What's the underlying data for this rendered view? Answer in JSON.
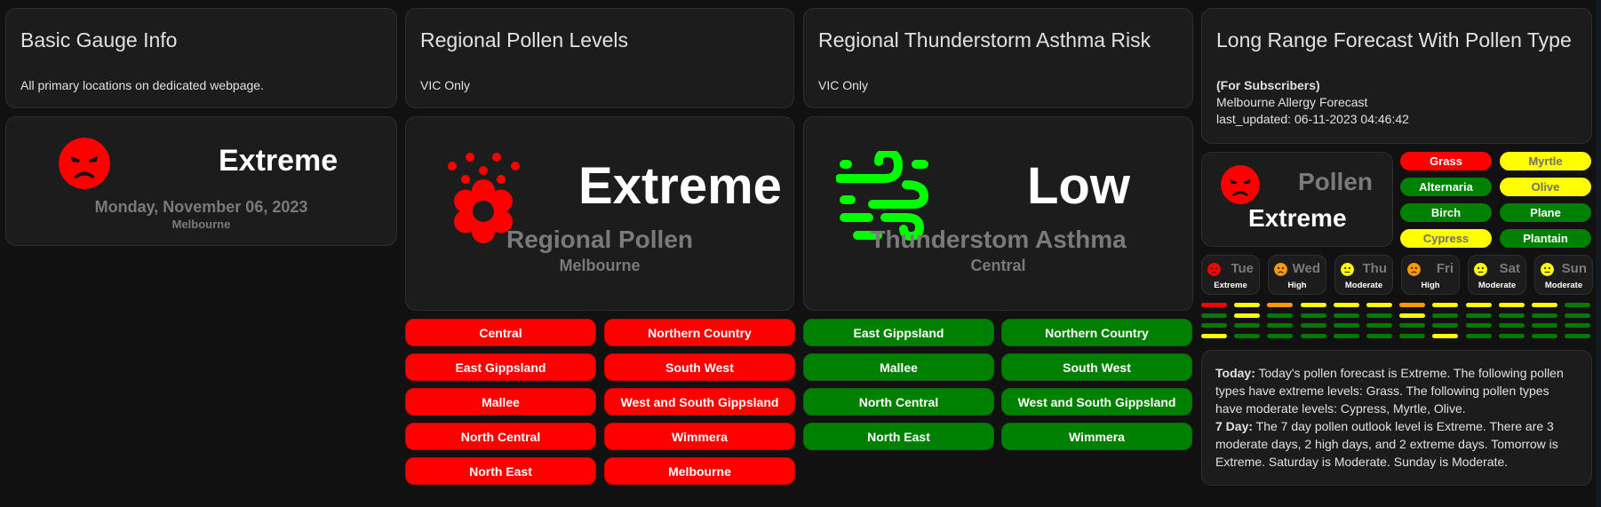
{
  "colors": {
    "extreme": "#ff0000",
    "high": "#ff9900",
    "moderate": "#ffff00",
    "low": "#008000",
    "low_bright": "#00ff00",
    "card_bg": "#1c1c1c",
    "page_bg": "#111111",
    "muted_text": "#7a7a7a"
  },
  "basic_gauge": {
    "header_title": "Basic Gauge Info",
    "header_subtitle": "All primary locations on dedicated webpage.",
    "icon": "angry-face-icon",
    "value": "Extreme",
    "date": "Monday, November 06, 2023",
    "location": "Melbourne"
  },
  "regional_pollen": {
    "header_title": "Regional Pollen Levels",
    "header_subtitle": "VIC Only",
    "icon": "flower-pollen-icon",
    "value": "Extreme",
    "name": "Regional Pollen",
    "location": "Melbourne",
    "regions": [
      {
        "label": "Central",
        "level": "extreme"
      },
      {
        "label": "Northern Country",
        "level": "extreme"
      },
      {
        "label": "East Gippsland",
        "level": "extreme"
      },
      {
        "label": "South West",
        "level": "extreme"
      },
      {
        "label": "Mallee",
        "level": "extreme"
      },
      {
        "label": "West and South Gippsland",
        "level": "extreme"
      },
      {
        "label": "North Central",
        "level": "extreme"
      },
      {
        "label": "Wimmera",
        "level": "extreme"
      },
      {
        "label": "North East",
        "level": "extreme"
      },
      {
        "label": "Melbourne",
        "level": "extreme"
      }
    ]
  },
  "thunderstorm_asthma": {
    "header_title": "Regional Thunderstorm Asthma Risk",
    "header_subtitle": "VIC Only",
    "icon": "wind-icon",
    "value": "Low",
    "name": "Thunderstom Asthma",
    "location": "Central",
    "regions": [
      {
        "label": "East Gippsland",
        "level": "low"
      },
      {
        "label": "Northern Country",
        "level": "low"
      },
      {
        "label": "Mallee",
        "level": "low"
      },
      {
        "label": "South West",
        "level": "low"
      },
      {
        "label": "North Central",
        "level": "low"
      },
      {
        "label": "West and South Gippsland",
        "level": "low"
      },
      {
        "label": "North East",
        "level": "low"
      },
      {
        "label": "Wimmera",
        "level": "low"
      }
    ]
  },
  "long_range": {
    "header_title": "Long Range Forecast With Pollen Type",
    "subscribers": "(For Subscribers)",
    "forecast_name": "Melbourne Allergy Forecast",
    "last_updated": "last_updated: 06-11-2023 04:46:42",
    "gauge": {
      "icon": "angry-face-icon",
      "name": "Pollen",
      "value": "Extreme"
    },
    "pollen_types": [
      {
        "label": "Grass",
        "level": "extreme"
      },
      {
        "label": "Myrtle",
        "level": "moderate"
      },
      {
        "label": "Alternaria",
        "level": "low"
      },
      {
        "label": "Olive",
        "level": "moderate"
      },
      {
        "label": "Birch",
        "level": "low"
      },
      {
        "label": "Plane",
        "level": "low"
      },
      {
        "label": "Cypress",
        "level": "moderate"
      },
      {
        "label": "Plantain",
        "level": "low"
      }
    ],
    "days": [
      {
        "day": "Tue",
        "level": "Extreme",
        "face": "angry-face-icon",
        "color": "#ff0000"
      },
      {
        "day": "Wed",
        "level": "High",
        "face": "frown-face-icon",
        "color": "#ff9900"
      },
      {
        "day": "Thu",
        "level": "Moderate",
        "face": "neutral-face-icon",
        "color": "#ffff00"
      },
      {
        "day": "Fri",
        "level": "High",
        "face": "frown-face-icon",
        "color": "#ff9900"
      },
      {
        "day": "Sat",
        "level": "Moderate",
        "face": "neutral-face-icon",
        "color": "#ffff00"
      },
      {
        "day": "Sun",
        "level": "Moderate",
        "face": "neutral-face-icon",
        "color": "#ffff00"
      }
    ],
    "level_bars": [
      [
        "extreme",
        "moderate",
        "high",
        "moderate",
        "moderate",
        "moderate",
        "high",
        "moderate",
        "moderate",
        "moderate",
        "moderate",
        "low"
      ],
      [
        "low",
        "moderate",
        "low",
        "low",
        "low",
        "low",
        "moderate",
        "low",
        "low",
        "low",
        "low",
        "low"
      ],
      [
        "low",
        "low",
        "low",
        "low",
        "low",
        "low",
        "low",
        "low",
        "low",
        "low",
        "low",
        "low"
      ],
      [
        "moderate",
        "low",
        "low",
        "low",
        "low",
        "low",
        "low",
        "moderate",
        "low",
        "low",
        "low",
        "low"
      ]
    ],
    "summary": {
      "today_label": "Today:",
      "today_text": " Today's pollen forecast is Extreme. The following pollen types have extreme levels: Grass. The following pollen types have moderate levels: Cypress, Myrtle, Olive.",
      "week_label": "7 Day:",
      "week_text": " The 7 day pollen outlook level is Extreme. There are 3 moderate days, 2 high days, and 2 extreme days. Tomorrow is Extreme. Saturday is Moderate. Sunday is Moderate."
    }
  }
}
